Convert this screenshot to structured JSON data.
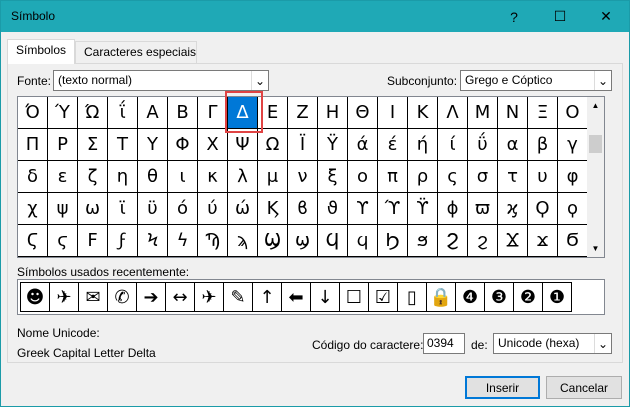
{
  "window": {
    "title": "Símbolo"
  },
  "tabs": [
    {
      "label": "Símbolos",
      "active": true
    },
    {
      "label": "Caracteres especiais",
      "active": false
    }
  ],
  "font": {
    "label": "Fonte:",
    "value": "(texto normal)"
  },
  "subset": {
    "label": "Subconjunto:",
    "value": "Grego e Cóptico"
  },
  "grid": {
    "selected_row": 0,
    "selected_col": 7,
    "rows": [
      [
        "Ό",
        "Ύ",
        "Ώ",
        "ΐ",
        "Α",
        "Β",
        "Γ",
        "Δ",
        "Ε",
        "Ζ",
        "Η",
        "Θ",
        "Ι",
        "Κ",
        "Λ",
        "Μ",
        "Ν",
        "Ξ",
        "Ο"
      ],
      [
        "Π",
        "Ρ",
        "Σ",
        "Τ",
        "Υ",
        "Φ",
        "Χ",
        "Ψ",
        "Ω",
        "Ϊ",
        "Ϋ",
        "ά",
        "έ",
        "ή",
        "ί",
        "ΰ",
        "α",
        "β",
        "γ"
      ],
      [
        "δ",
        "ε",
        "ζ",
        "η",
        "θ",
        "ι",
        "κ",
        "λ",
        "μ",
        "ν",
        "ξ",
        "ο",
        "π",
        "ρ",
        "ς",
        "σ",
        "τ",
        "υ",
        "φ"
      ],
      [
        "χ",
        "ψ",
        "ω",
        "ϊ",
        "ϋ",
        "ό",
        "ύ",
        "ώ",
        "Ϗ",
        "ϐ",
        "ϑ",
        "ϒ",
        "ϓ",
        "ϔ",
        "ϕ",
        "ϖ",
        "ϗ",
        "Ϙ",
        "ϙ"
      ],
      [
        "Ϛ",
        "ϛ",
        "Ϝ",
        "ϝ",
        "Ϟ",
        "ϟ",
        "Ϡ",
        "ϡ",
        "Ϣ",
        "ϣ",
        "Ϥ",
        "ϥ",
        "Ϧ",
        "ϧ",
        "Ϩ",
        "ϩ",
        "Ϫ",
        "ϫ",
        "Ϭ"
      ]
    ]
  },
  "recent": {
    "label": "Símbolos usados recentemente:",
    "items": [
      "☻",
      "✈",
      "✉",
      "✆",
      "➔",
      "↔",
      "✈",
      "✎",
      "↑",
      "⬅",
      "↓",
      "☐",
      "☑",
      "▯",
      "🔒",
      "❹",
      "❸",
      "❷",
      "❶"
    ]
  },
  "unicode_name": {
    "label": "Nome Unicode:",
    "value": "Greek Capital Letter Delta"
  },
  "char_code": {
    "label": "Código do caractere:",
    "value": "0394"
  },
  "from": {
    "label": "de:",
    "value": "Unicode (hexa)"
  },
  "buttons": {
    "insert": "Inserir",
    "cancel": "Cancelar"
  },
  "icons": {
    "help": "?",
    "maximize": "☐",
    "close": "✕",
    "dropdown": "⌄",
    "scroll_up": "▲",
    "scroll_down": "▼"
  }
}
